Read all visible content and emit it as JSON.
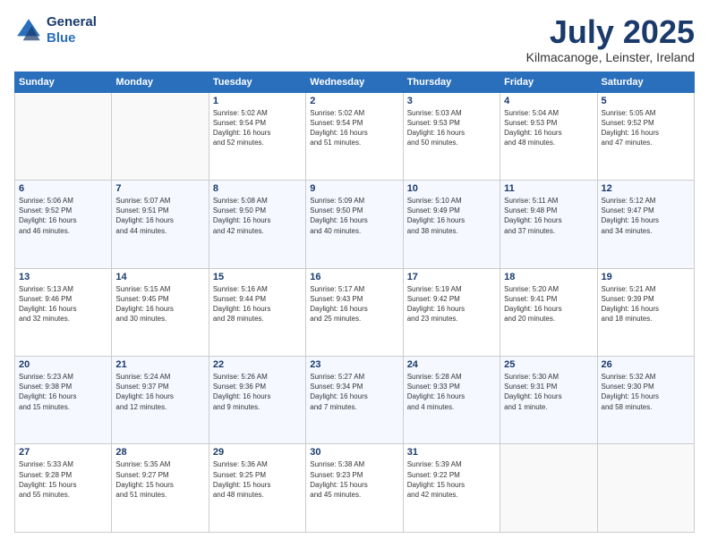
{
  "header": {
    "logo_line1": "General",
    "logo_line2": "Blue",
    "month": "July 2025",
    "location": "Kilmacanoge, Leinster, Ireland"
  },
  "weekdays": [
    "Sunday",
    "Monday",
    "Tuesday",
    "Wednesday",
    "Thursday",
    "Friday",
    "Saturday"
  ],
  "weeks": [
    [
      {
        "day": "",
        "info": ""
      },
      {
        "day": "",
        "info": ""
      },
      {
        "day": "1",
        "info": "Sunrise: 5:02 AM\nSunset: 9:54 PM\nDaylight: 16 hours\nand 52 minutes."
      },
      {
        "day": "2",
        "info": "Sunrise: 5:02 AM\nSunset: 9:54 PM\nDaylight: 16 hours\nand 51 minutes."
      },
      {
        "day": "3",
        "info": "Sunrise: 5:03 AM\nSunset: 9:53 PM\nDaylight: 16 hours\nand 50 minutes."
      },
      {
        "day": "4",
        "info": "Sunrise: 5:04 AM\nSunset: 9:53 PM\nDaylight: 16 hours\nand 48 minutes."
      },
      {
        "day": "5",
        "info": "Sunrise: 5:05 AM\nSunset: 9:52 PM\nDaylight: 16 hours\nand 47 minutes."
      }
    ],
    [
      {
        "day": "6",
        "info": "Sunrise: 5:06 AM\nSunset: 9:52 PM\nDaylight: 16 hours\nand 46 minutes."
      },
      {
        "day": "7",
        "info": "Sunrise: 5:07 AM\nSunset: 9:51 PM\nDaylight: 16 hours\nand 44 minutes."
      },
      {
        "day": "8",
        "info": "Sunrise: 5:08 AM\nSunset: 9:50 PM\nDaylight: 16 hours\nand 42 minutes."
      },
      {
        "day": "9",
        "info": "Sunrise: 5:09 AM\nSunset: 9:50 PM\nDaylight: 16 hours\nand 40 minutes."
      },
      {
        "day": "10",
        "info": "Sunrise: 5:10 AM\nSunset: 9:49 PM\nDaylight: 16 hours\nand 38 minutes."
      },
      {
        "day": "11",
        "info": "Sunrise: 5:11 AM\nSunset: 9:48 PM\nDaylight: 16 hours\nand 37 minutes."
      },
      {
        "day": "12",
        "info": "Sunrise: 5:12 AM\nSunset: 9:47 PM\nDaylight: 16 hours\nand 34 minutes."
      }
    ],
    [
      {
        "day": "13",
        "info": "Sunrise: 5:13 AM\nSunset: 9:46 PM\nDaylight: 16 hours\nand 32 minutes."
      },
      {
        "day": "14",
        "info": "Sunrise: 5:15 AM\nSunset: 9:45 PM\nDaylight: 16 hours\nand 30 minutes."
      },
      {
        "day": "15",
        "info": "Sunrise: 5:16 AM\nSunset: 9:44 PM\nDaylight: 16 hours\nand 28 minutes."
      },
      {
        "day": "16",
        "info": "Sunrise: 5:17 AM\nSunset: 9:43 PM\nDaylight: 16 hours\nand 25 minutes."
      },
      {
        "day": "17",
        "info": "Sunrise: 5:19 AM\nSunset: 9:42 PM\nDaylight: 16 hours\nand 23 minutes."
      },
      {
        "day": "18",
        "info": "Sunrise: 5:20 AM\nSunset: 9:41 PM\nDaylight: 16 hours\nand 20 minutes."
      },
      {
        "day": "19",
        "info": "Sunrise: 5:21 AM\nSunset: 9:39 PM\nDaylight: 16 hours\nand 18 minutes."
      }
    ],
    [
      {
        "day": "20",
        "info": "Sunrise: 5:23 AM\nSunset: 9:38 PM\nDaylight: 16 hours\nand 15 minutes."
      },
      {
        "day": "21",
        "info": "Sunrise: 5:24 AM\nSunset: 9:37 PM\nDaylight: 16 hours\nand 12 minutes."
      },
      {
        "day": "22",
        "info": "Sunrise: 5:26 AM\nSunset: 9:36 PM\nDaylight: 16 hours\nand 9 minutes."
      },
      {
        "day": "23",
        "info": "Sunrise: 5:27 AM\nSunset: 9:34 PM\nDaylight: 16 hours\nand 7 minutes."
      },
      {
        "day": "24",
        "info": "Sunrise: 5:28 AM\nSunset: 9:33 PM\nDaylight: 16 hours\nand 4 minutes."
      },
      {
        "day": "25",
        "info": "Sunrise: 5:30 AM\nSunset: 9:31 PM\nDaylight: 16 hours\nand 1 minute."
      },
      {
        "day": "26",
        "info": "Sunrise: 5:32 AM\nSunset: 9:30 PM\nDaylight: 15 hours\nand 58 minutes."
      }
    ],
    [
      {
        "day": "27",
        "info": "Sunrise: 5:33 AM\nSunset: 9:28 PM\nDaylight: 15 hours\nand 55 minutes."
      },
      {
        "day": "28",
        "info": "Sunrise: 5:35 AM\nSunset: 9:27 PM\nDaylight: 15 hours\nand 51 minutes."
      },
      {
        "day": "29",
        "info": "Sunrise: 5:36 AM\nSunset: 9:25 PM\nDaylight: 15 hours\nand 48 minutes."
      },
      {
        "day": "30",
        "info": "Sunrise: 5:38 AM\nSunset: 9:23 PM\nDaylight: 15 hours\nand 45 minutes."
      },
      {
        "day": "31",
        "info": "Sunrise: 5:39 AM\nSunset: 9:22 PM\nDaylight: 15 hours\nand 42 minutes."
      },
      {
        "day": "",
        "info": ""
      },
      {
        "day": "",
        "info": ""
      }
    ]
  ]
}
